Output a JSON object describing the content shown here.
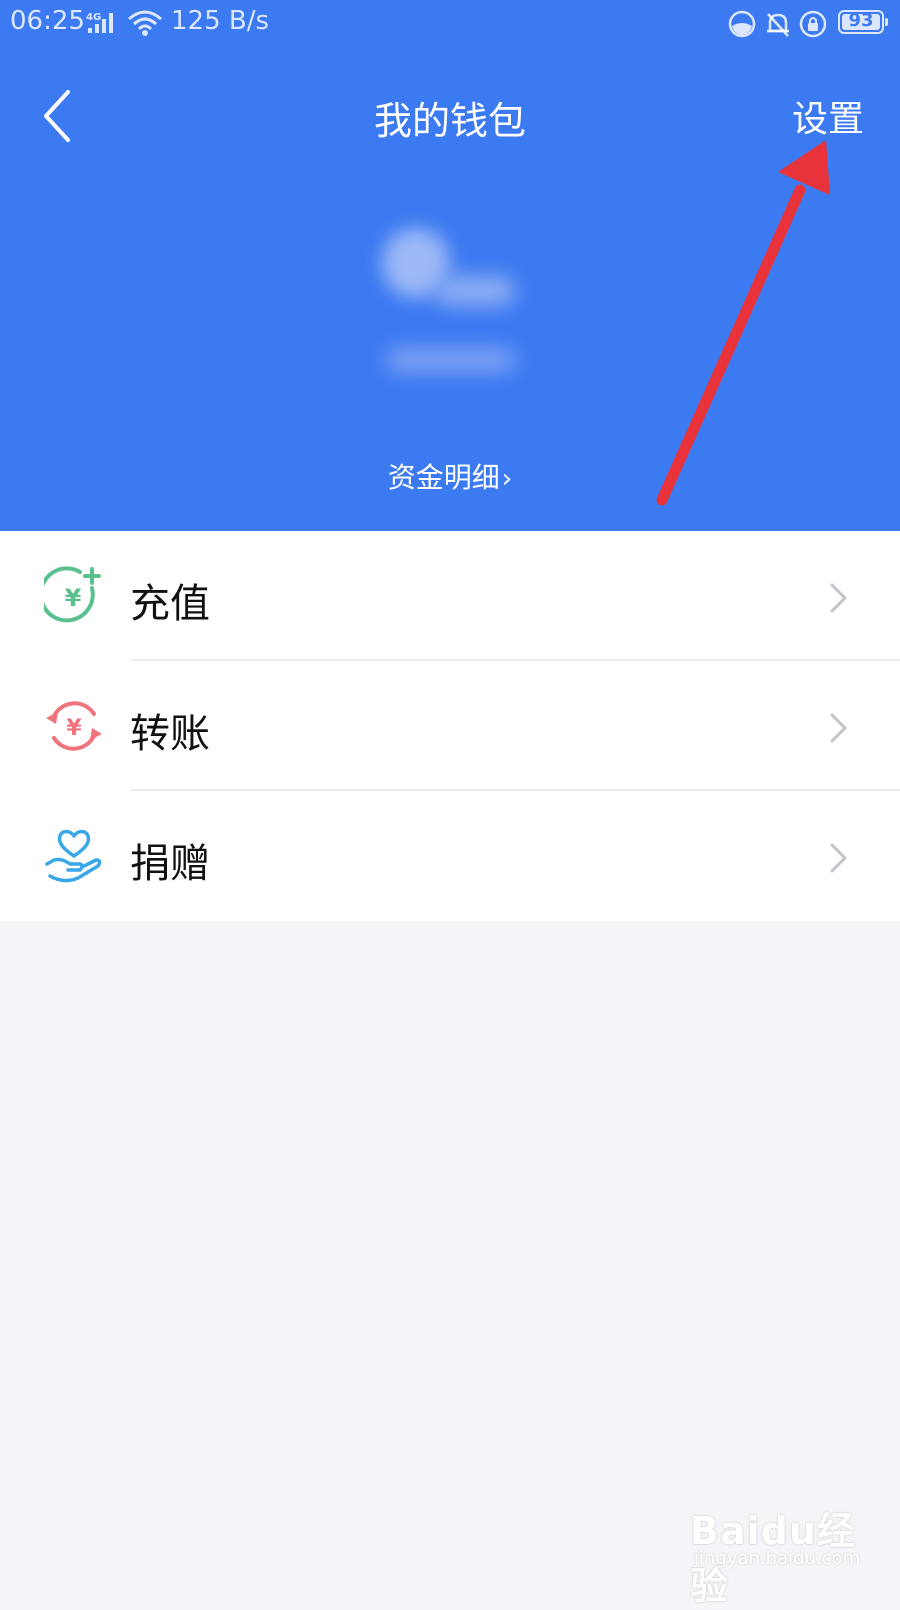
{
  "status_bar": {
    "time": "06:25",
    "network": "4G",
    "speed": "125 B/s",
    "battery": "93"
  },
  "header": {
    "title": "我的钱包",
    "settings_label": "设置",
    "funds_detail_label": "资金明细",
    "background_color": "#3c7af1"
  },
  "menu": {
    "items": [
      {
        "label": "充值",
        "icon": "recharge-yuan-plus-icon",
        "color": "#5ac18e"
      },
      {
        "label": "转账",
        "icon": "transfer-yuan-cycle-icon",
        "color": "#f0737d"
      },
      {
        "label": "捐赠",
        "icon": "donate-heart-hand-icon",
        "color": "#3aa7e8"
      }
    ]
  },
  "annotation": {
    "arrow_color": "#e8333b"
  },
  "watermark": {
    "brand": "Baidu经验",
    "url": "jingyan.baidu.com"
  }
}
